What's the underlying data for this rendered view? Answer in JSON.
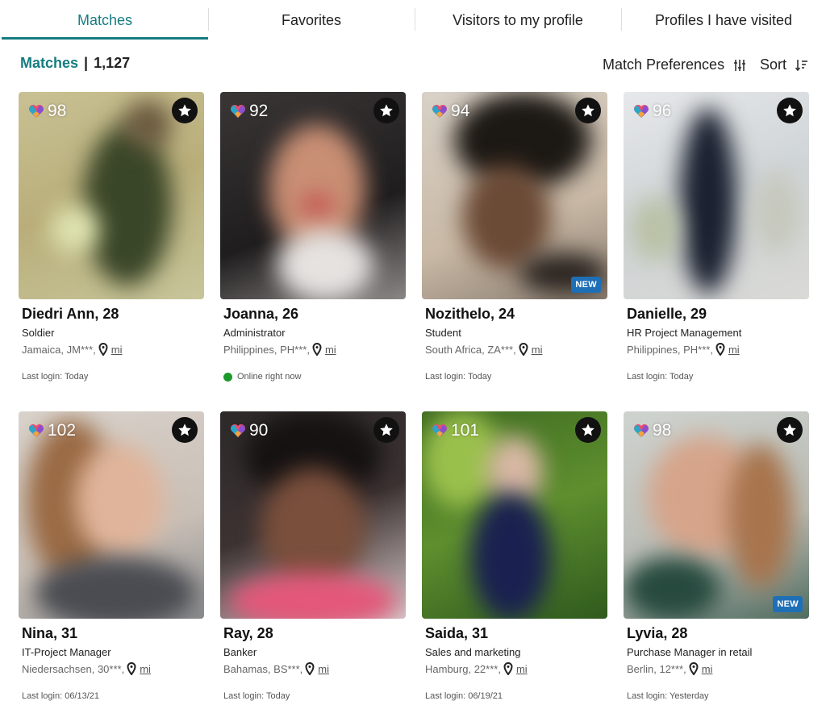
{
  "tabs": [
    {
      "label": "Matches",
      "active": true
    },
    {
      "label": "Favorites"
    },
    {
      "label": "Visitors to my profile"
    },
    {
      "label": "Profiles I have visited"
    }
  ],
  "header": {
    "title": "Matches",
    "separator": "|",
    "count": "1,127",
    "preferences_label": "Match Preferences",
    "sort_label": "Sort"
  },
  "colors": {
    "accent": "#167c80",
    "new_badge": "#1f6fb7",
    "online": "#1d9a2b"
  },
  "profiles": [
    {
      "name": "Diedri Ann, 28",
      "job": "Soldier",
      "location": "Jamaica, JM***,",
      "distance": "mi",
      "score": "98",
      "status": "Last login: Today",
      "new": ""
    },
    {
      "name": "Joanna, 26",
      "job": "Administrator",
      "location": "Philippines, PH***,",
      "distance": "mi",
      "score": "92",
      "status": "Online right now",
      "new": ""
    },
    {
      "name": "Nozithelo, 24",
      "job": "Student",
      "location": "South Africa, ZA***,",
      "distance": "mi",
      "score": "94",
      "status": "Last login: Today",
      "new": "NEW"
    },
    {
      "name": "Danielle, 29",
      "job": "HR Project Management",
      "location": "Philippines, PH***,",
      "distance": "mi",
      "score": "96",
      "status": "Last login: Today",
      "new": ""
    },
    {
      "name": "Nina, 31",
      "job": "IT-Project Manager",
      "location": "Niedersachsen, 30***,",
      "distance": "mi",
      "score": "102",
      "status": "Last login: 06/13/21",
      "new": ""
    },
    {
      "name": "Ray, 28",
      "job": "Banker",
      "location": "Bahamas, BS***,",
      "distance": "mi",
      "score": "90",
      "status": "Last login: Today",
      "new": ""
    },
    {
      "name": "Saida, 31",
      "job": "Sales and marketing",
      "location": "Hamburg, 22***,",
      "distance": "mi",
      "score": "101",
      "status": "Last login: 06/19/21",
      "new": ""
    },
    {
      "name": "Lyvia, 28",
      "job": "Purchase Manager in retail",
      "location": "Berlin, 12***,",
      "distance": "mi",
      "score": "98",
      "status": "Last login: Yesterday",
      "new": "NEW"
    }
  ]
}
